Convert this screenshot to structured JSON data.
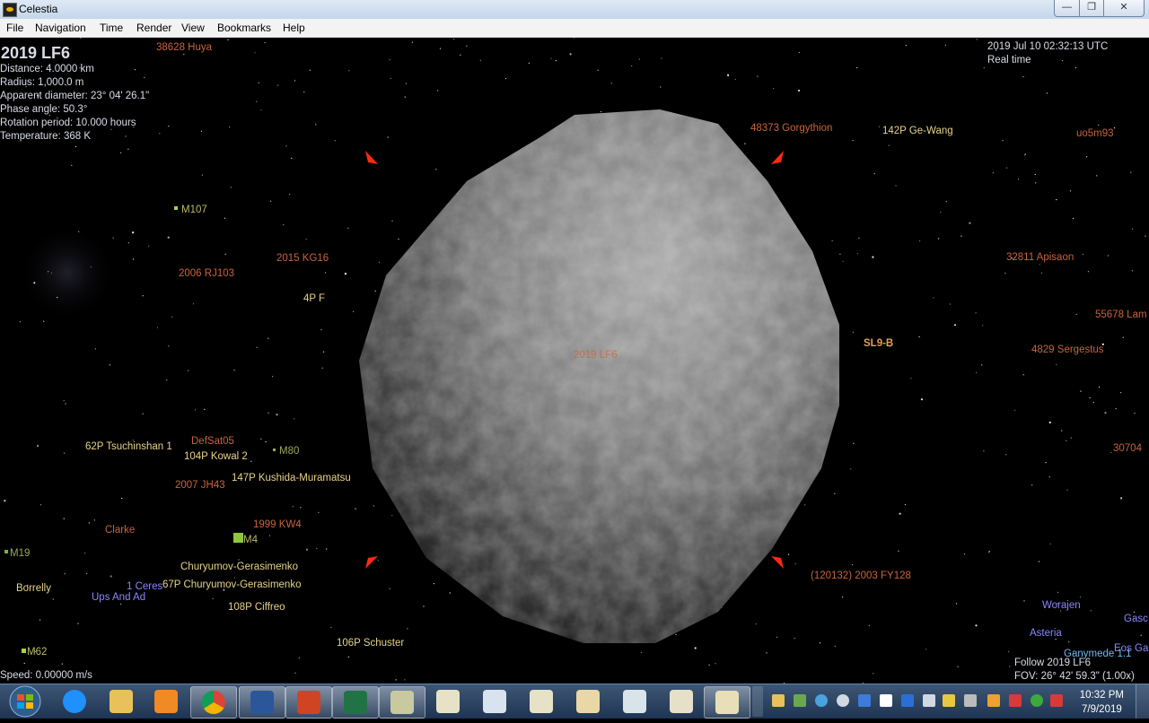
{
  "window": {
    "title": "Celestia",
    "minimize_icon": "minimize-icon",
    "maximize_icon": "maximize-icon",
    "close_icon": "close-icon"
  },
  "menubar": [
    "File",
    "Navigation",
    "Time",
    "Render",
    "View",
    "Bookmarks",
    "Help"
  ],
  "hud": {
    "object_name": "2019 LF6",
    "info": [
      "Distance: 4.0000 km",
      "Radius: 1,000.0 m",
      "Apparent diameter: 23° 04' 26.1\"",
      "Phase angle: 50.3°",
      "Rotation period: 10.000 hours",
      "Temperature: 368 K"
    ],
    "datetime": "2019 Jul 10 02:32:13 UTC",
    "time_mode": "Real time",
    "speed": "Speed: 0.00000 m/s",
    "follow": "Follow 2019 LF6",
    "fov": "FOV: 26° 42' 59.3\" (1.00x)"
  },
  "labels": [
    {
      "text": "38628 Huya",
      "color": "#c8643c"
    },
    {
      "text": "48373 Gorgythion",
      "color": "#c8643c"
    },
    {
      "text": "142P Ge-Wang",
      "color": "#e6d28a"
    },
    {
      "text": "uo5m93",
      "color": "#c8643c"
    },
    {
      "text": "M107",
      "color": "#b9bb6a"
    },
    {
      "text": "2006 RJ103",
      "color": "#c8643c"
    },
    {
      "text": "2015 KG16",
      "color": "#c8643c"
    },
    {
      "text": "32811 Apisaon",
      "color": "#c8643c"
    },
    {
      "text": "4P F",
      "color": "#e6d28a"
    },
    {
      "text": "55678 Lam",
      "color": "#c8643c"
    },
    {
      "text": "SL9-B",
      "color": "#e0a050"
    },
    {
      "text": "4829 Sergestus",
      "color": "#c8643c"
    },
    {
      "text": "2019 LF6",
      "color": "#c8643c"
    },
    {
      "text": "62P Tsuchinshan 1",
      "color": "#e6d28a"
    },
    {
      "text": "DefSat05",
      "color": "#c8643c"
    },
    {
      "text": "M80",
      "color": "#9aa85a"
    },
    {
      "text": "104P Kowal 2",
      "color": "#e6d28a"
    },
    {
      "text": "30704",
      "color": "#c8643c"
    },
    {
      "text": "2007 JH43",
      "color": "#c8643c"
    },
    {
      "text": "147P Kushida-Muramatsu",
      "color": "#e6d28a"
    },
    {
      "text": "Clarke",
      "color": "#c8643c"
    },
    {
      "text": "1999 KW4",
      "color": "#c8643c"
    },
    {
      "text": "M4",
      "color": "#b9bb6a"
    },
    {
      "text": "M19",
      "color": "#9aa85a"
    },
    {
      "text": "Churyumov-Gerasimenko",
      "color": "#e6d28a"
    },
    {
      "text": "(120132) 2003 FY128",
      "color": "#c8643c"
    },
    {
      "text": "Borrelly",
      "color": "#e6d28a"
    },
    {
      "text": "1 Ceres",
      "color": "#8a86ff"
    },
    {
      "text": "67P Churyumov-Gerasimenko",
      "color": "#e6d28a"
    },
    {
      "text": "Ups And Ad",
      "color": "#8a86ff"
    },
    {
      "text": "108P Ciffreo",
      "color": "#e6d28a"
    },
    {
      "text": "Worajen",
      "color": "#8a86ff"
    },
    {
      "text": "Gasc",
      "color": "#8a86ff"
    },
    {
      "text": "Asteria",
      "color": "#8a86ff"
    },
    {
      "text": "106P Schuster",
      "color": "#e6d28a"
    },
    {
      "text": "Ganymede 1.1",
      "color": "#6fb8ee"
    },
    {
      "text": "Eos Ga",
      "color": "#8a86ff"
    },
    {
      "text": "M62",
      "color": "#b9bb6a"
    }
  ],
  "taskbar": {
    "apps": [
      "internet-explorer-icon",
      "file-explorer-icon",
      "media-player-icon",
      "chrome-icon",
      "word-icon",
      "powerpoint-icon",
      "excel-icon",
      "celestia-icon",
      "document-icon-1",
      "document-icon-2",
      "document-icon-3",
      "document-icon-4",
      "document-icon-5",
      "document-icon-6",
      "document-icon-7"
    ],
    "tray": [
      "network-icon",
      "security-icon",
      "cloud-icon",
      "dropbox-icon",
      "flag-icon",
      "display-icon",
      "volume-icon",
      "shield-icon",
      "signal-icon",
      "app-icon-1",
      "app-icon-2",
      "app-icon-3",
      "app-icon-4"
    ],
    "time": "10:32 PM",
    "date": "7/9/2019"
  }
}
